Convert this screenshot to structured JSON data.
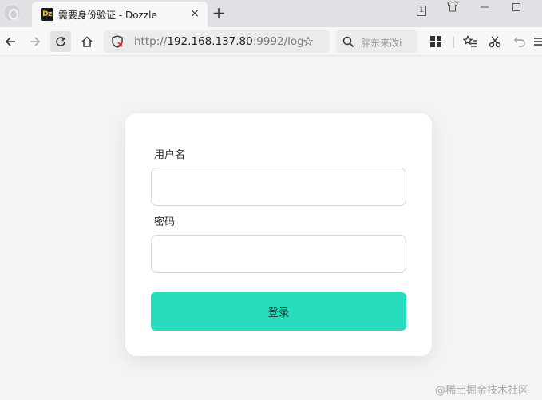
{
  "tab": {
    "favicon_text": "Dz",
    "title": "需要身份验证 - Dozzle",
    "close_glyph": "×",
    "new_tab_glyph": "+"
  },
  "window": {
    "tab_count": "1"
  },
  "toolbar": {
    "url_scheme": "http://",
    "url_host": "192.168.137.80",
    "url_rest": ":9992/log",
    "search_placeholder": "胖东来改i"
  },
  "login": {
    "username_label": "用户名",
    "username_value": "",
    "password_label": "密码",
    "password_value": "",
    "submit_label": "登录"
  },
  "watermark": "@稀土掘金技术社区",
  "colors": {
    "primary_button": "#27dbbc",
    "page_background": "#f4f4f4"
  }
}
